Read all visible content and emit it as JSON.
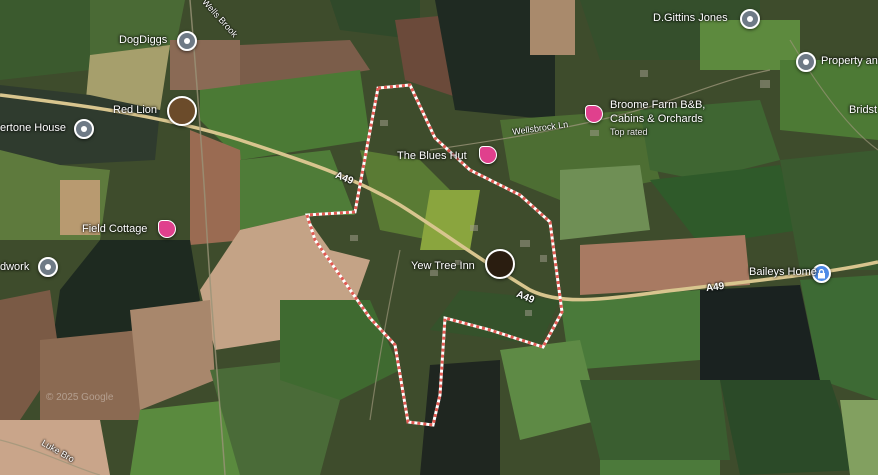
{
  "places": {
    "dgittins": "D.Gittins Jones",
    "dogdiggs": "DogDiggs",
    "property": "Property and",
    "red_lion": "Red Lion",
    "broome_name_1": "Broome Farm B&B,",
    "broome_name_2": "Cabins & Orchards",
    "broome_sub": "Top rated",
    "blues_hut": "The Blues Hut",
    "field_cottage": "Field Cottage",
    "yew_tree": "Yew Tree Inn",
    "baileys": "Baileys Home",
    "bristol_partial": "Bridst",
    "wertone": "ertone House",
    "dwork": "dwork"
  },
  "roads": {
    "a49_1": "A49",
    "a49_2": "A49",
    "a49_3": "A49",
    "wells_brook": "Wells Brook",
    "wellsbrook_ln": "Wellsbrock Ln",
    "luke_brook": "Luke Bro"
  },
  "watermark": "© 2025 Google",
  "colors": {
    "boundary": "#e05a52",
    "hotel_pin": "#e0408d",
    "lock_pin": "#4d8ae6",
    "grey_pin": "#6e7a86"
  }
}
